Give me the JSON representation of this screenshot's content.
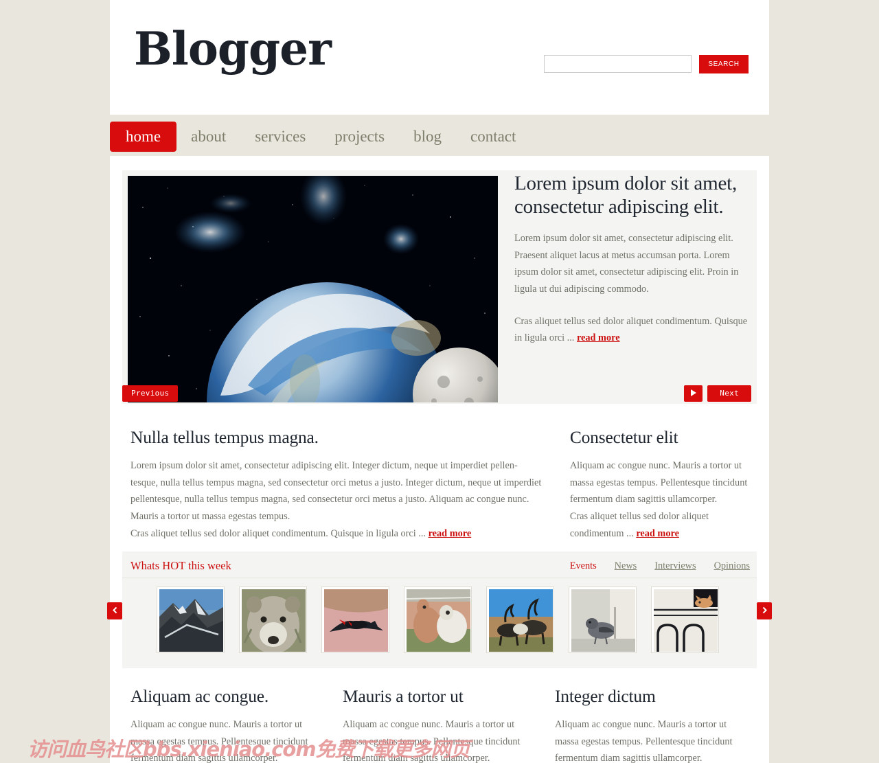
{
  "site": {
    "logo": "Blogger"
  },
  "search": {
    "value": "",
    "placeholder": "",
    "button_label": "SEARCH"
  },
  "nav": {
    "items": [
      {
        "label": "home",
        "active": true
      },
      {
        "label": "about",
        "active": false
      },
      {
        "label": "services",
        "active": false
      },
      {
        "label": "projects",
        "active": false
      },
      {
        "label": "blog",
        "active": false
      },
      {
        "label": "contact",
        "active": false
      }
    ]
  },
  "hero": {
    "title": "Lorem ipsum dolor sit amet, consectetur adipiscing elit.",
    "paragraph1": "Lorem ipsum dolor sit amet, consectetur adipiscing elit. Praesent aliquet lacus at metus accumsan porta. Lorem ipsum dolor sit amet, consectetur adipiscing elit. Proin in ligula ut dui adipiscing commodo.",
    "paragraph2": "Cras aliquet tellus sed dolor aliquet condimentum. Quisque in ligula orci ... ",
    "read_more": "read more",
    "previous_label": "Previous",
    "next_label": "Next",
    "play_icon": "play-icon",
    "image_alt": "earth-from-space-with-moon"
  },
  "intro": {
    "left": {
      "title": "Nulla tellus tempus magna.",
      "body": "Lorem ipsum dolor sit amet, consectetur adipiscing elit. Integer dictum, neque ut imperdiet pellen- tesque, nulla tellus tempus magna, sed consectetur orci metus a justo. Integer dictum, neque ut imperdiet pellentesque, nulla tellus tempus magna, sed consectetur orci metus a justo. Aliquam ac congue nunc. Mauris a tortor ut massa egestas tempus.",
      "body2": "Cras aliquet tellus sed dolor aliquet condimentum. Quisque in ligula orci ... ",
      "read_more": "read more"
    },
    "right": {
      "title": "Consectetur elit",
      "body": "Aliquam ac congue nunc. Mauris a tortor ut massa egestas tempus. Pellentesque tincidunt fermentum diam sagittis ullamcorper.",
      "body2": "Cras aliquet tellus sed dolor aliquet condimentum ... ",
      "read_more": "read more"
    }
  },
  "hot": {
    "title": "Whats HOT this week",
    "tabs": [
      {
        "label": "Events",
        "active": true
      },
      {
        "label": "News",
        "active": false
      },
      {
        "label": "Interviews",
        "active": false
      },
      {
        "label": "Opinions",
        "active": false
      }
    ],
    "prev_icon": "chevron-left-icon",
    "next_icon": "chevron-right-icon",
    "thumbnails": [
      {
        "alt": "mountain-ridge-with-snow"
      },
      {
        "alt": "grizzly-bear-portrait"
      },
      {
        "alt": "red-winged-blackbird-in-flight"
      },
      {
        "alt": "kangaroo-and-white-dog"
      },
      {
        "alt": "reindeer-herd-blue-sky"
      },
      {
        "alt": "pigeon-on-pavement"
      },
      {
        "alt": "cat-on-white-arches"
      }
    ]
  },
  "bottom": {
    "columns": [
      {
        "title": "Aliquam ac congue.",
        "body": "Aliquam ac congue nunc. Mauris a tortor ut massa egestas tempus. Pellentesque tincidunt fermentum diam sagittis ullamcorper."
      },
      {
        "title": "Mauris a tortor ut",
        "body": "Aliquam ac congue nunc. Mauris a tortor ut massa egestas tempus. Pellentesque tincidunt fermentum diam sagittis ullamcorper."
      },
      {
        "title": "Integer dictum",
        "body": "Aliquam ac congue nunc. Mauris a tortor ut massa egestas tempus. Pellentesque tincidunt fermentum diam sagittis ullamcorper."
      }
    ]
  },
  "watermark": {
    "text": "访问血鸟社区bbs.xieniao.com免费下载更多网页"
  },
  "colors": {
    "accent_red": "#d80c0c",
    "link_red": "#cc1111",
    "page_bg": "#e9e6dd",
    "card_bg": "#ffffff",
    "panel_bg": "#f4f4f2",
    "body_text": "#6f7168",
    "heading_text": "#1f2630",
    "nav_text": "#7d7f6c"
  }
}
